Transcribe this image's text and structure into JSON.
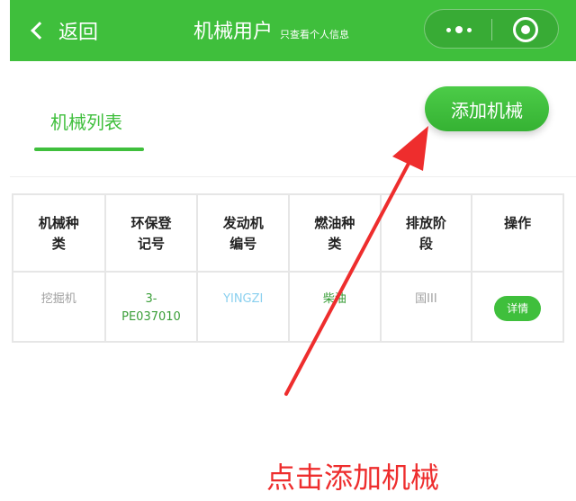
{
  "header": {
    "back_label": "返回",
    "title": "机械用户",
    "subtitle": "只查看个人信息",
    "background": "#3fbf3c"
  },
  "tab": {
    "label": "机械列表"
  },
  "add_button": {
    "label": "添加机械"
  },
  "table": {
    "headers": [
      [
        "机械种",
        "类"
      ],
      [
        "环保登",
        "记号"
      ],
      [
        "发动机",
        "编号"
      ],
      [
        "燃油种",
        "类"
      ],
      [
        "排放阶",
        "段"
      ],
      [
        "操作"
      ]
    ],
    "row": {
      "type": "挖掘机",
      "reg_line1": "3-",
      "reg_line2": "PE037010",
      "engine": "YINGZI",
      "fuel": "柴油",
      "emission": "国III",
      "action": "详情"
    }
  },
  "annotation": {
    "caption": "点击添加机械",
    "color": "#ee2d2d"
  }
}
